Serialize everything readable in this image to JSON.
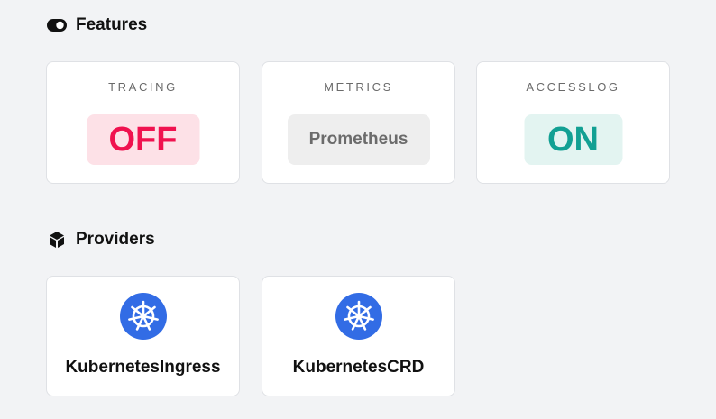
{
  "features": {
    "title": "Features",
    "icon": "toggle-icon",
    "items": [
      {
        "name": "TRACING",
        "value": "OFF",
        "status": "off"
      },
      {
        "name": "METRICS",
        "value": "Prometheus",
        "status": "neutral"
      },
      {
        "name": "ACCESSLOG",
        "value": "ON",
        "status": "on"
      }
    ]
  },
  "providers": {
    "title": "Providers",
    "icon": "cube-icon",
    "items": [
      {
        "name": "KubernetesIngress",
        "icon": "kubernetes-icon"
      },
      {
        "name": "KubernetesCRD",
        "icon": "kubernetes-icon"
      }
    ]
  },
  "colors": {
    "background": "#f2f3f5",
    "off": "#f0124f",
    "on": "#12a093",
    "kubernetes": "#326ce5"
  }
}
